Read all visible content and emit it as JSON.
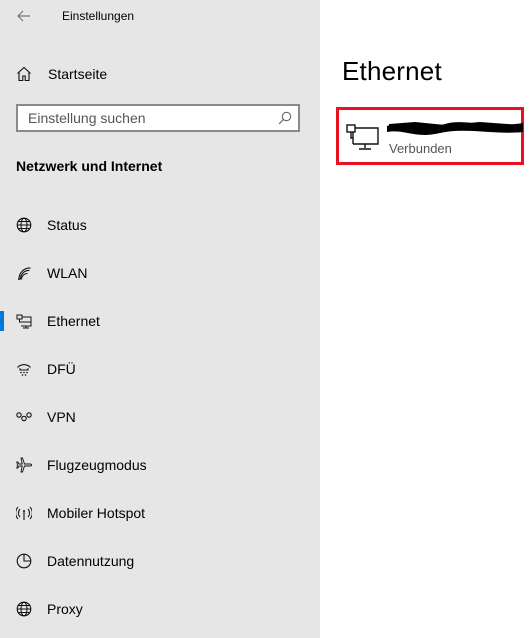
{
  "window": {
    "title": "Einstellungen"
  },
  "sidebar": {
    "home_label": "Startseite",
    "search_placeholder": "Einstellung suchen",
    "section_heading": "Netzwerk und Internet",
    "items": [
      {
        "label": "Status",
        "icon": "globe-icon",
        "selected": false
      },
      {
        "label": "WLAN",
        "icon": "wifi-icon",
        "selected": false
      },
      {
        "label": "Ethernet",
        "icon": "ethernet-icon",
        "selected": true
      },
      {
        "label": "DFÜ",
        "icon": "dialup-icon",
        "selected": false
      },
      {
        "label": "VPN",
        "icon": "vpn-icon",
        "selected": false
      },
      {
        "label": "Flugzeugmodus",
        "icon": "airplane-icon",
        "selected": false
      },
      {
        "label": "Mobiler Hotspot",
        "icon": "hotspot-icon",
        "selected": false
      },
      {
        "label": "Datennutzung",
        "icon": "data-usage-icon",
        "selected": false
      },
      {
        "label": "Proxy",
        "icon": "globe-icon",
        "selected": false
      }
    ]
  },
  "main": {
    "title": "Ethernet",
    "connection": {
      "name": "",
      "status": "Verbunden"
    }
  },
  "colors": {
    "sidebar_bg": "#e6e6e6",
    "accent": "#0078d7",
    "highlight_border": "#e81123"
  }
}
